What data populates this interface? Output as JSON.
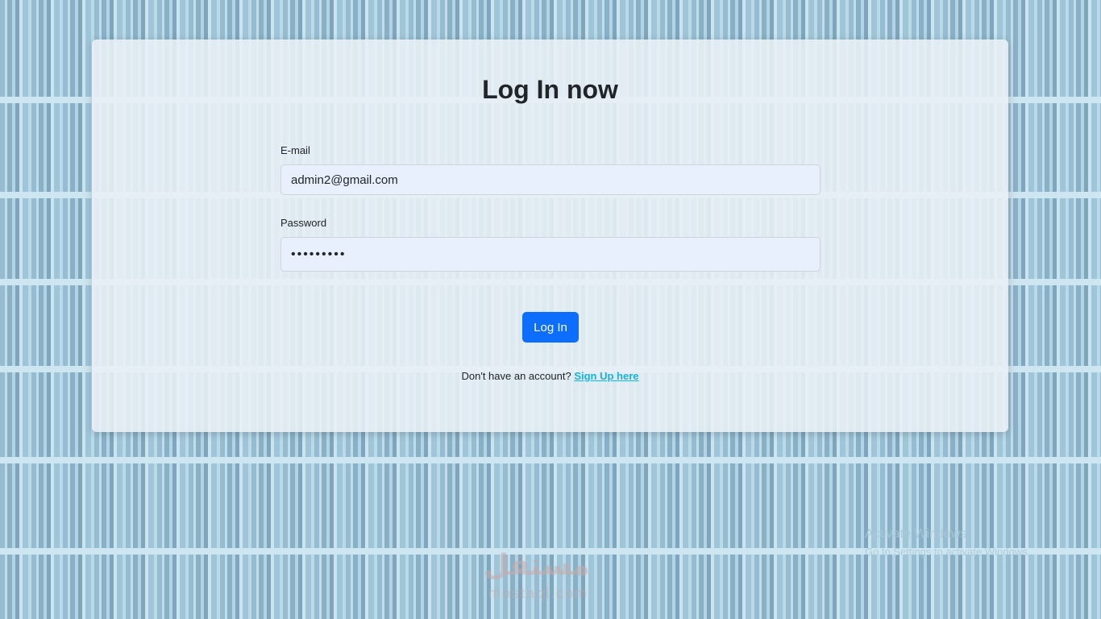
{
  "page": {
    "title": "Log In now"
  },
  "form": {
    "email_label": "E-mail",
    "email_value": "admin2@gmail.com",
    "password_label": "Password",
    "password_value": "•••••••••",
    "submit_label": "Log In"
  },
  "signup": {
    "prompt": "Don't have an account?",
    "link_label": "Sign Up here"
  },
  "os_watermark": {
    "title": "Activate Windows",
    "subtitle": "Go to Settings to activate Windows."
  },
  "site_watermark": {
    "logo": "مستقل",
    "sub": "mostaql.com"
  },
  "colors": {
    "primary_button": "#0d6efd",
    "link": "#17b3d4",
    "input_bg": "#e8f0fe",
    "background": "#a9cfe2"
  }
}
